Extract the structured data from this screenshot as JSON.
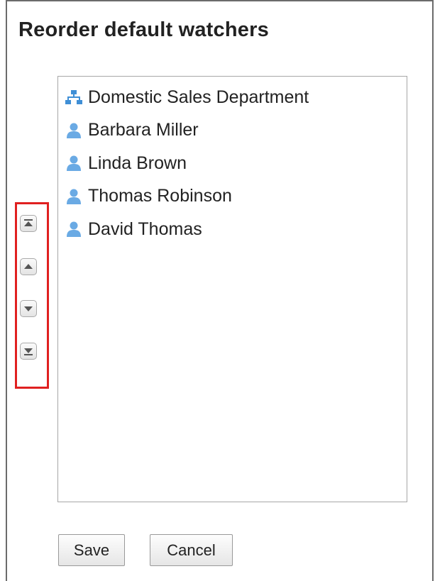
{
  "dialog": {
    "title": "Reorder default watchers"
  },
  "watchers": [
    {
      "label": "Domestic Sales Department",
      "icon": "organization-icon"
    },
    {
      "label": "Barbara Miller",
      "icon": "user-icon"
    },
    {
      "label": "Linda Brown",
      "icon": "user-icon"
    },
    {
      "label": "Thomas Robinson",
      "icon": "user-icon"
    },
    {
      "label": "David Thomas",
      "icon": "user-icon"
    }
  ],
  "order_buttons": [
    "move-to-top-icon",
    "move-up-icon",
    "move-down-icon",
    "move-to-bottom-icon"
  ],
  "actions": {
    "save_label": "Save",
    "cancel_label": "Cancel"
  },
  "colors": {
    "icon_blue": "#5b9bd5",
    "highlight_red": "#e02020"
  }
}
